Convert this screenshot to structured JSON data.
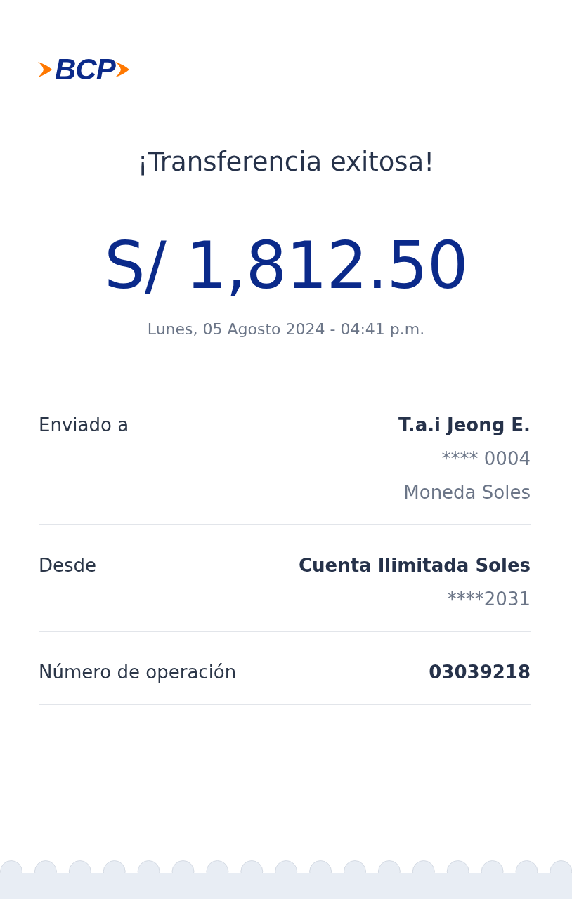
{
  "logo": {
    "text": "BCP"
  },
  "title": "¡Transferencia exitosa!",
  "amount": "S/ 1,812.50",
  "datetime": "Lunes, 05 Agosto 2024 - 04:41 p.m.",
  "details": [
    {
      "label": "Enviado a",
      "primary": "T.a.i Jeong E.",
      "secondary": [
        "**** 0004",
        "Moneda Soles"
      ]
    },
    {
      "label": "Desde",
      "primary": "Cuenta Ilimitada Soles",
      "secondary": [
        "****2031"
      ]
    },
    {
      "label": "Número de operación",
      "primary": "03039218"
    }
  ]
}
